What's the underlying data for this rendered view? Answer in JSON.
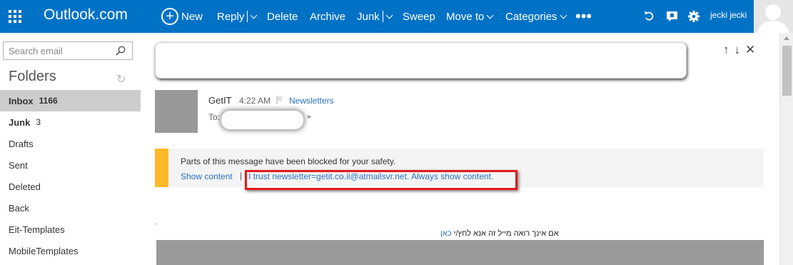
{
  "app": {
    "brand": "Outlook.com",
    "accent_color": "#0072c6"
  },
  "toolbar": {
    "new_label": "New",
    "reply_label": "Reply",
    "delete_label": "Delete",
    "archive_label": "Archive",
    "junk_label": "Junk",
    "sweep_label": "Sweep",
    "move_to_label": "Move to",
    "categories_label": "Categories",
    "more_label": "•••"
  },
  "header_right": {
    "undo_icon": "undo-icon",
    "chat_icon": "chat-icon",
    "settings_icon": "gear-icon",
    "username": "jecki jecki"
  },
  "sidebar": {
    "search_placeholder": "Search email",
    "folders_heading": "Folders",
    "items": [
      {
        "label": "Inbox",
        "count": "1166",
        "selected": true
      },
      {
        "label": "Junk",
        "count": "3",
        "selected": false
      },
      {
        "label": "Drafts",
        "count": "",
        "selected": false
      },
      {
        "label": "Sent",
        "count": "",
        "selected": false
      },
      {
        "label": "Deleted",
        "count": "",
        "selected": false
      },
      {
        "label": "Back",
        "count": "",
        "selected": false
      },
      {
        "label": "Eit-Templates",
        "count": "",
        "selected": false
      },
      {
        "label": "MobileTemplates",
        "count": "",
        "selected": false
      }
    ]
  },
  "message": {
    "sender": "GetIT",
    "time": "4:22 AM",
    "category": "Newsletters",
    "to_label": "To:",
    "expand_glyph": "»",
    "safety_message": "Parts of this message have been blocked for your safety.",
    "show_content": "Show content",
    "separator": "|",
    "trust_link": "I trust newsletter=getit.co.il@atmailsvr.net. Always show content.",
    "hebrew_text": "אם אינך רואה מייל זה אנא לחץ/י",
    "hebrew_link": "כאן",
    "safety_color": "#fdb927",
    "annotation_color": "#e11b1b"
  }
}
